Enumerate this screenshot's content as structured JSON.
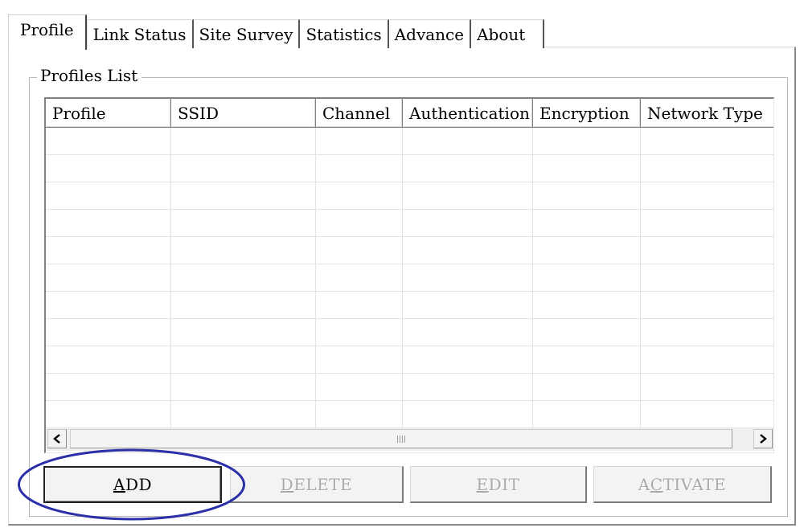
{
  "tabs": [
    {
      "label": "Profile"
    },
    {
      "label": "Link Status"
    },
    {
      "label": "Site Survey"
    },
    {
      "label": "Statistics"
    },
    {
      "label": "Advance"
    },
    {
      "label": "About"
    }
  ],
  "group": {
    "label": "Profiles List"
  },
  "table": {
    "columns": [
      "Profile",
      "SSID",
      "Channel",
      "Authentication",
      "Encryption",
      "Network Type"
    ],
    "rows": []
  },
  "buttons": {
    "add": {
      "label_mn": "A",
      "label_rest": "DD"
    },
    "delete": {
      "label_mn": "D",
      "label_rest": "ELETE"
    },
    "edit": {
      "label_mn": "E",
      "label_rest": "DIT"
    },
    "activate": {
      "label_pre": "A",
      "label_mn": "C",
      "label_rest": "TIVATE"
    }
  },
  "annotation": {
    "color": "#2b2fa8"
  },
  "icons": {
    "scroll_left": "left-arrow-icon",
    "scroll_right": "right-arrow-icon",
    "scroll_grip": "grip-icon"
  }
}
